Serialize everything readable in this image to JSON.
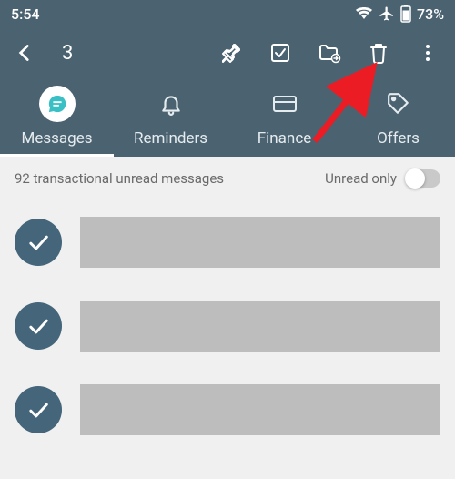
{
  "status": {
    "time": "5:54",
    "battery": "73%"
  },
  "toolbar": {
    "selected_count": "3"
  },
  "tabs": {
    "messages": "Messages",
    "reminders": "Reminders",
    "finance": "Finance",
    "offers": "Offers"
  },
  "filter": {
    "summary": "92  transactional unread messages",
    "toggle_label": "Unread only"
  }
}
